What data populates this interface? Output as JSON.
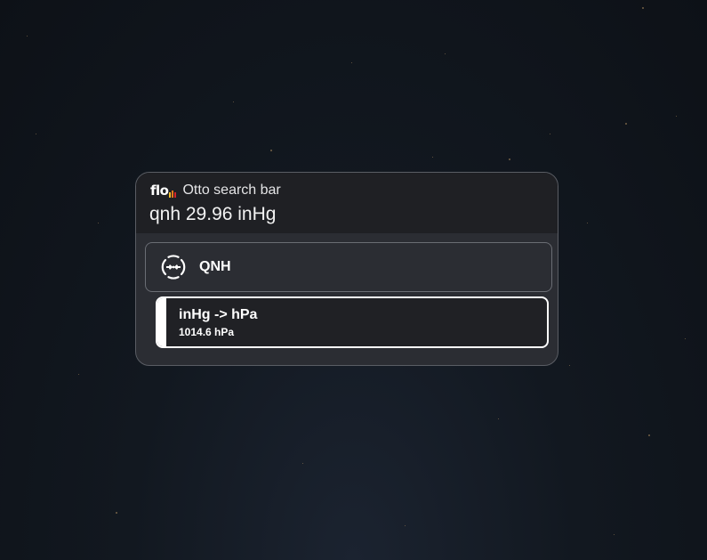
{
  "app": {
    "logo_text": "flo",
    "hint": "Otto search bar",
    "query": "qnh 29.96 inHg",
    "logo_bar_colors": [
      "#f2c230",
      "#f07a1a",
      "#d4242a"
    ]
  },
  "results": {
    "qnh": {
      "label": "QNH",
      "icon": "pressure-gauge-icon"
    },
    "conversion": {
      "title": "inHg -> hPa",
      "subtitle": "1014.6 hPa"
    }
  },
  "colors": {
    "background": "#121820",
    "panel": "#2b2d33",
    "search_area": "#1f2024",
    "selected_border": "#ffffff"
  }
}
